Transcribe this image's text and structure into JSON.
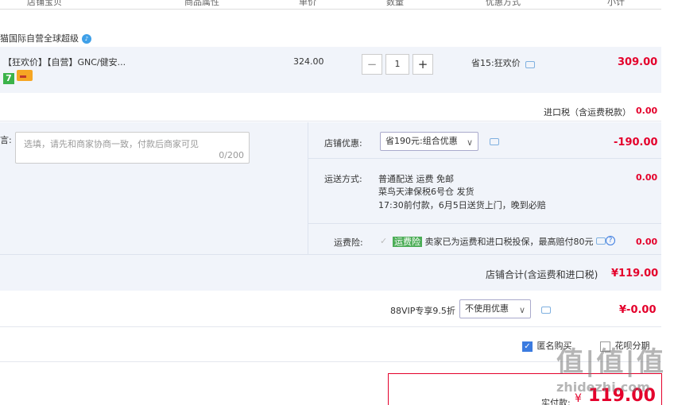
{
  "header": {
    "col_shop": "店铺宝贝",
    "col_attr": "商品属性",
    "col_price": "单价",
    "col_qty": "数量",
    "col_promo": "优惠方式",
    "col_subtotal": "小计"
  },
  "shop": {
    "name": "猫国际自营全球超级"
  },
  "product": {
    "title": "【狂欢价】【自营】GNC/健安...",
    "badge_seven": "7",
    "unit_price": "324.00",
    "quantity": "1",
    "minus": "−",
    "plus": "+",
    "promo": "省15:狂欢价",
    "subtotal": "309.00"
  },
  "import_tax": {
    "label": "进口税（含运费税款）",
    "value": "0.00"
  },
  "message": {
    "label": "言:",
    "placeholder": "选填，请先和商家协商一致，付款后商家可见",
    "counter": "0/200"
  },
  "shop_discount": {
    "label": "店铺优惠:",
    "selected": "省190元:组合优惠",
    "value": "-190.00"
  },
  "shipping": {
    "label": "运送方式:",
    "line1": "普通配送 运费 免邮",
    "line2": "菜鸟天津保税6号仓   发货",
    "line3": "17:30前付款，6月5日送货上门，晚到必赔",
    "value": "0.00"
  },
  "shipping_insurance": {
    "label": "运费险:",
    "tag": "运费险",
    "text": "卖家已为运费和进口税投保，最高赔付80元",
    "value": "0.00"
  },
  "shop_total": {
    "label": "店铺合计(含运费和进口税)",
    "value": "¥119.00"
  },
  "vip": {
    "label": "88VIP专享9.5折",
    "selected": "不使用优惠",
    "value": "¥-0.00"
  },
  "options": {
    "anonymous": "匿名购买",
    "other": "花呗分期"
  },
  "pay": {
    "label": "实付款:",
    "currency": "¥",
    "amount": "119.00"
  },
  "watermark": {
    "text": "值|值|值",
    "domain": "zhidezhi.com"
  },
  "colors": {
    "accent_red": "#e4002b",
    "panel_bg": "#f1f4fa",
    "link_blue": "#3b7be0"
  }
}
